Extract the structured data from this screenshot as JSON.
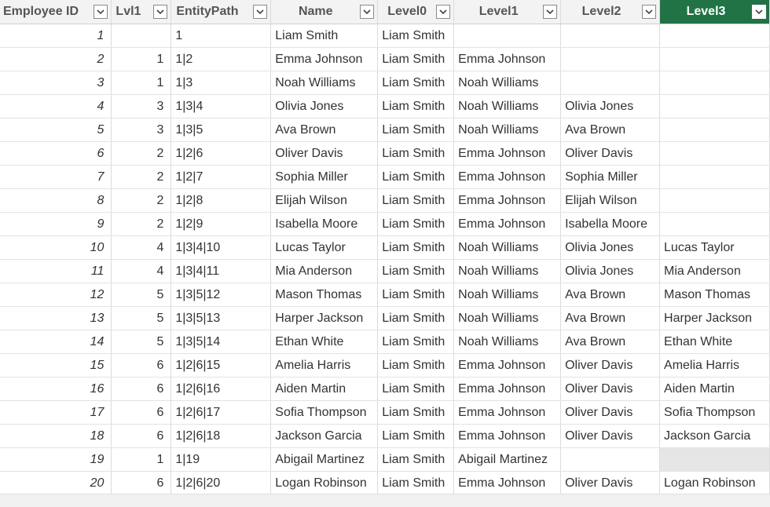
{
  "columns": [
    {
      "label": "Employee ID",
      "active": false
    },
    {
      "label": "Lvl1",
      "active": false
    },
    {
      "label": "EntityPath",
      "active": false
    },
    {
      "label": "Name",
      "active": false
    },
    {
      "label": "Level0",
      "active": false
    },
    {
      "label": "Level1",
      "active": false
    },
    {
      "label": "Level2",
      "active": false
    },
    {
      "label": "Level3",
      "active": true
    }
  ],
  "header_active_color": "#217346",
  "rows": [
    {
      "id": "1",
      "lvl1": "",
      "path": "1",
      "name": "Liam Smith",
      "l0": "Liam Smith",
      "l1": "",
      "l2": "",
      "l3": ""
    },
    {
      "id": "2",
      "lvl1": "1",
      "path": "1|2",
      "name": "Emma Johnson",
      "l0": "Liam Smith",
      "l1": "Emma Johnson",
      "l2": "",
      "l3": ""
    },
    {
      "id": "3",
      "lvl1": "1",
      "path": "1|3",
      "name": "Noah Williams",
      "l0": "Liam Smith",
      "l1": "Noah Williams",
      "l2": "",
      "l3": ""
    },
    {
      "id": "4",
      "lvl1": "3",
      "path": "1|3|4",
      "name": "Olivia Jones",
      "l0": "Liam Smith",
      "l1": "Noah Williams",
      "l2": "Olivia Jones",
      "l3": ""
    },
    {
      "id": "5",
      "lvl1": "3",
      "path": "1|3|5",
      "name": "Ava Brown",
      "l0": "Liam Smith",
      "l1": "Noah Williams",
      "l2": "Ava Brown",
      "l3": ""
    },
    {
      "id": "6",
      "lvl1": "2",
      "path": "1|2|6",
      "name": "Oliver Davis",
      "l0": "Liam Smith",
      "l1": "Emma Johnson",
      "l2": "Oliver Davis",
      "l3": ""
    },
    {
      "id": "7",
      "lvl1": "2",
      "path": "1|2|7",
      "name": "Sophia Miller",
      "l0": "Liam Smith",
      "l1": "Emma Johnson",
      "l2": "Sophia Miller",
      "l3": ""
    },
    {
      "id": "8",
      "lvl1": "2",
      "path": "1|2|8",
      "name": "Elijah Wilson",
      "l0": "Liam Smith",
      "l1": "Emma Johnson",
      "l2": "Elijah Wilson",
      "l3": ""
    },
    {
      "id": "9",
      "lvl1": "2",
      "path": "1|2|9",
      "name": "Isabella Moore",
      "l0": "Liam Smith",
      "l1": "Emma Johnson",
      "l2": "Isabella Moore",
      "l3": ""
    },
    {
      "id": "10",
      "lvl1": "4",
      "path": "1|3|4|10",
      "name": "Lucas Taylor",
      "l0": "Liam Smith",
      "l1": "Noah Williams",
      "l2": "Olivia Jones",
      "l3": "Lucas Taylor"
    },
    {
      "id": "11",
      "lvl1": "4",
      "path": "1|3|4|11",
      "name": "Mia Anderson",
      "l0": "Liam Smith",
      "l1": "Noah Williams",
      "l2": "Olivia Jones",
      "l3": "Mia Anderson"
    },
    {
      "id": "12",
      "lvl1": "5",
      "path": "1|3|5|12",
      "name": "Mason Thomas",
      "l0": "Liam Smith",
      "l1": "Noah Williams",
      "l2": "Ava Brown",
      "l3": "Mason Thomas"
    },
    {
      "id": "13",
      "lvl1": "5",
      "path": "1|3|5|13",
      "name": "Harper Jackson",
      "l0": "Liam Smith",
      "l1": "Noah Williams",
      "l2": "Ava Brown",
      "l3": "Harper Jackson"
    },
    {
      "id": "14",
      "lvl1": "5",
      "path": "1|3|5|14",
      "name": "Ethan White",
      "l0": "Liam Smith",
      "l1": "Noah Williams",
      "l2": "Ava Brown",
      "l3": "Ethan White"
    },
    {
      "id": "15",
      "lvl1": "6",
      "path": "1|2|6|15",
      "name": "Amelia Harris",
      "l0": "Liam Smith",
      "l1": "Emma Johnson",
      "l2": "Oliver Davis",
      "l3": "Amelia Harris"
    },
    {
      "id": "16",
      "lvl1": "6",
      "path": "1|2|6|16",
      "name": "Aiden Martin",
      "l0": "Liam Smith",
      "l1": "Emma Johnson",
      "l2": "Oliver Davis",
      "l3": "Aiden Martin"
    },
    {
      "id": "17",
      "lvl1": "6",
      "path": "1|2|6|17",
      "name": "Sofia Thompson",
      "l0": "Liam Smith",
      "l1": "Emma Johnson",
      "l2": "Oliver Davis",
      "l3": "Sofia Thompson"
    },
    {
      "id": "18",
      "lvl1": "6",
      "path": "1|2|6|18",
      "name": "Jackson Garcia",
      "l0": "Liam Smith",
      "l1": "Emma Johnson",
      "l2": "Oliver Davis",
      "l3": "Jackson Garcia"
    },
    {
      "id": "19",
      "lvl1": "1",
      "path": "1|19",
      "name": "Abigail Martinez",
      "l0": "Liam Smith",
      "l1": "Abigail Martinez",
      "l2": "",
      "l3": "",
      "l3_highlight": true
    },
    {
      "id": "20",
      "lvl1": "6",
      "path": "1|2|6|20",
      "name": "Logan Robinson",
      "l0": "Liam Smith",
      "l1": "Emma Johnson",
      "l2": "Oliver Davis",
      "l3": "Logan Robinson"
    }
  ]
}
